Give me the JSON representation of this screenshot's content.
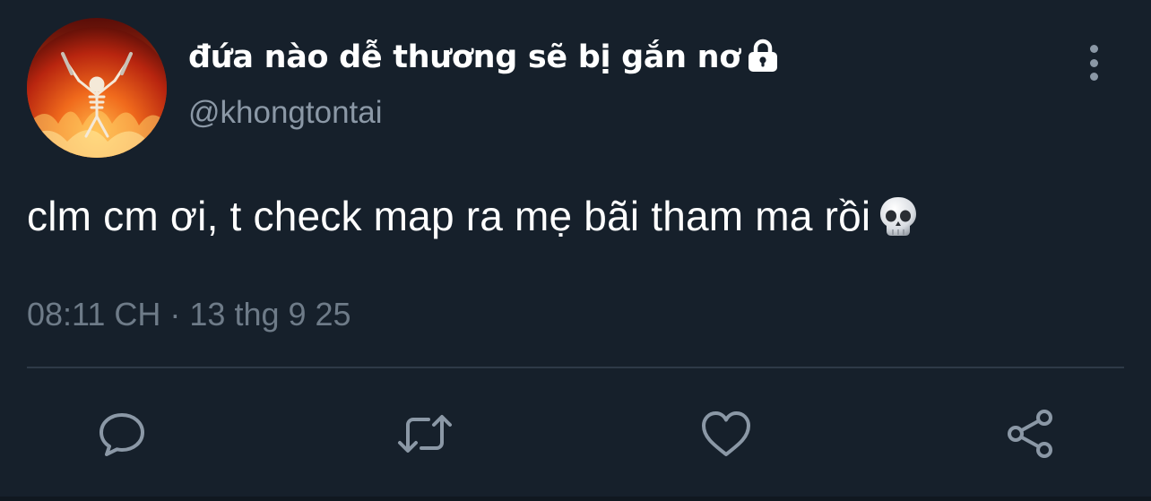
{
  "tweet": {
    "author": {
      "display_name": "đứa nào dễ thương sẽ bị gắn nơ",
      "handle": "@khongtontai",
      "protected_icon": "lock-icon"
    },
    "text": "clm cm ơi, t check map ra mẹ bãi tham ma rồi",
    "emoji": "skull-emoji",
    "timestamp": "08:11 CH · 13 thg 9 25"
  },
  "actions": [
    {
      "name": "reply",
      "icon": "comment-icon"
    },
    {
      "name": "retweet",
      "icon": "retweet-icon"
    },
    {
      "name": "like",
      "icon": "heart-icon"
    },
    {
      "name": "share",
      "icon": "share-icon"
    }
  ],
  "colors": {
    "background": "#16202b",
    "primary_text": "#ffffff",
    "secondary_text": "#8b98a6",
    "icon": "#8b98a6",
    "divider": "#2e3a47"
  }
}
